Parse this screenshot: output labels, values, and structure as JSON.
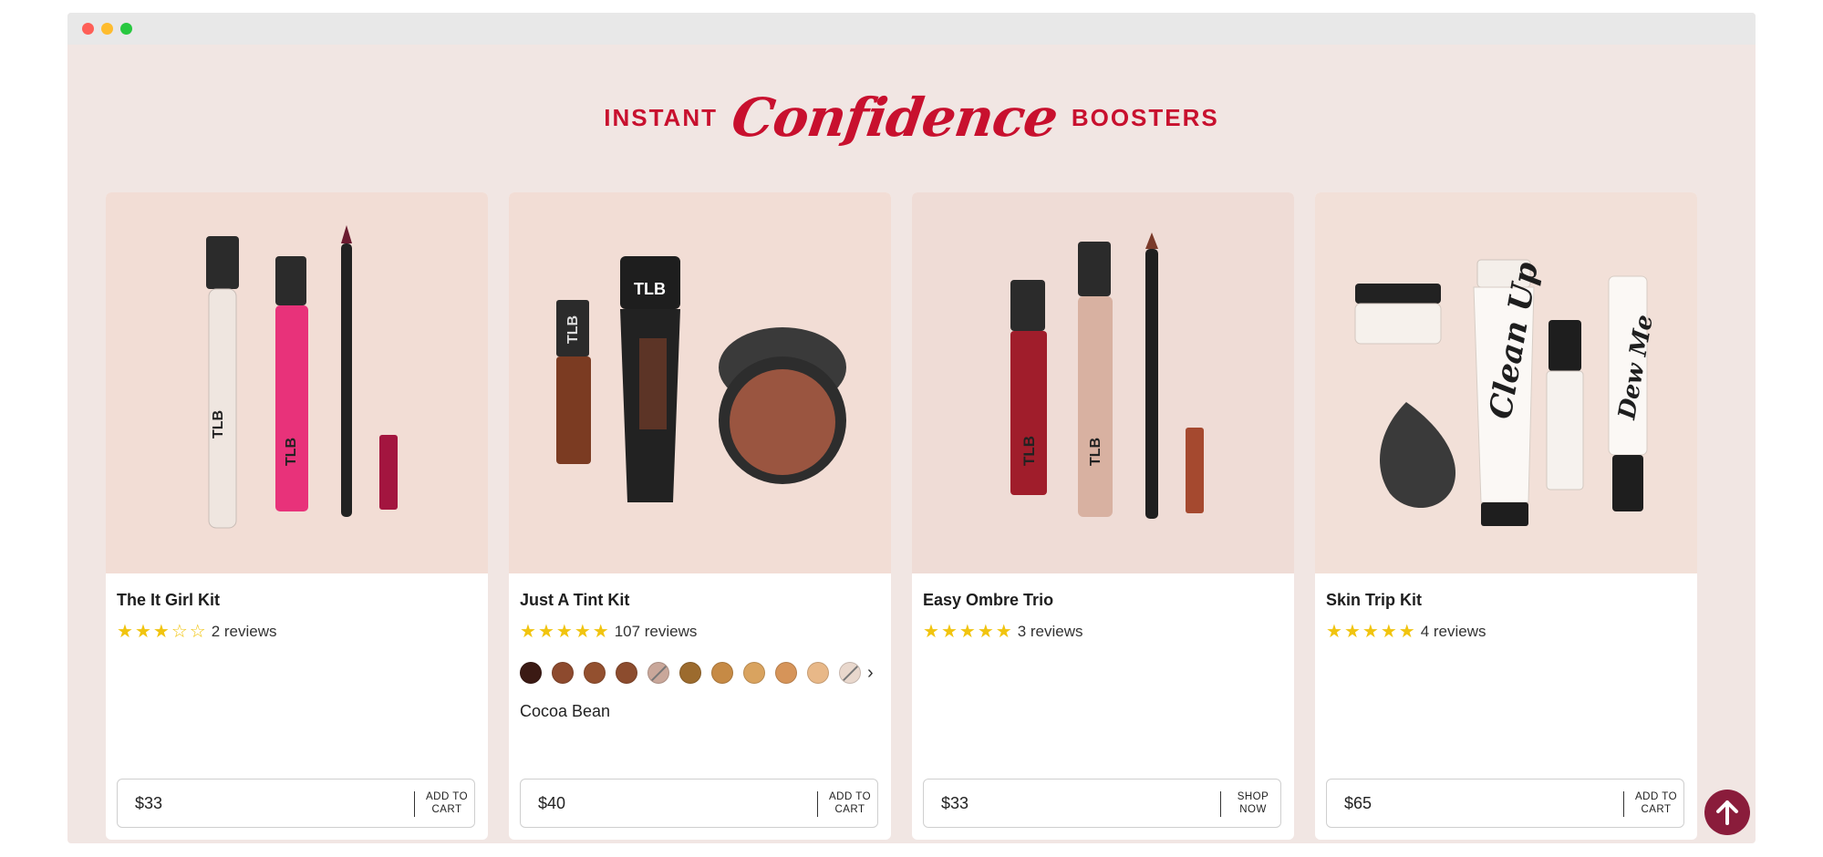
{
  "headline": {
    "left": "INSTANT",
    "script": "Confidence",
    "right": "BOOSTERS"
  },
  "colors": {
    "brand_red": "#c8102e",
    "star": "#f1c40f",
    "back_to_top": "#8a1c3b"
  },
  "products": [
    {
      "title": "The It Girl Kit",
      "rating": 3,
      "reviews": "2 reviews",
      "price": "$33",
      "action_line1": "ADD TO",
      "action_line2": "CART"
    },
    {
      "title": "Just A Tint Kit",
      "rating": 5,
      "reviews": "107 reviews",
      "price": "$40",
      "action_line1": "ADD TO",
      "action_line2": "CART",
      "shade_selected": "Cocoa Bean",
      "swatches": [
        "#3b1a14",
        "#8d4a2e",
        "#93502f",
        "#8c4c2e",
        "#c9a79a",
        "#9c6b2e",
        "#c68a45",
        "#d9a35f",
        "#d69459",
        "#e8b888",
        "#e9d8cd"
      ]
    },
    {
      "title": "Easy Ombre Trio",
      "rating": 5,
      "reviews": "3 reviews",
      "price": "$33",
      "action_line1": "SHOP",
      "action_line2": "NOW"
    },
    {
      "title": "Skin Trip Kit",
      "rating": 5,
      "reviews": "4 reviews",
      "price": "$65",
      "action_line1": "ADD TO",
      "action_line2": "CART"
    }
  ],
  "icons": {
    "back_to_top": "arrow-up-icon",
    "swatch_next": "chevron-right-icon"
  }
}
